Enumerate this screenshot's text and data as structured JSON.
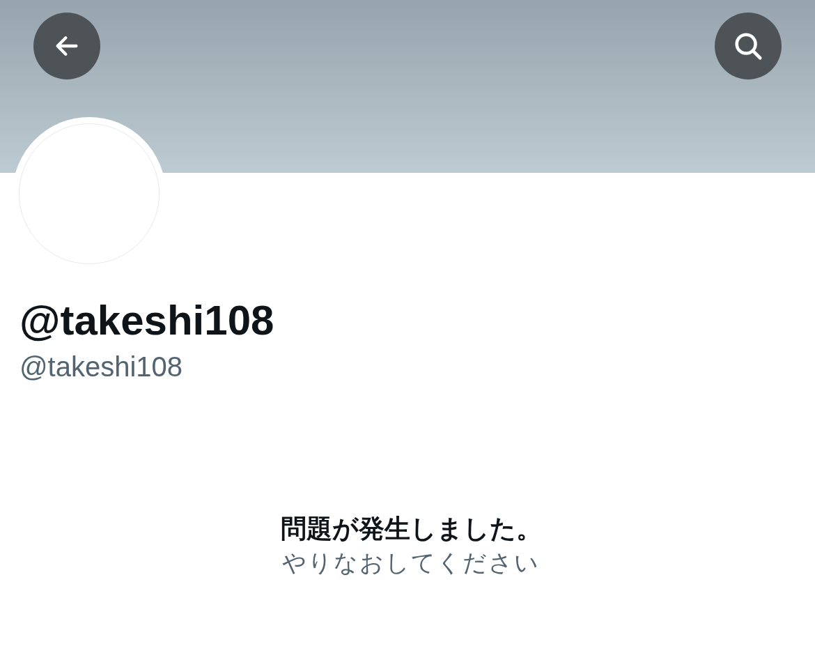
{
  "profile": {
    "display_name": "@takeshi108",
    "handle": "@takeshi108"
  },
  "error": {
    "title": "問題が発生しました。",
    "message": "やりなおしてください"
  }
}
